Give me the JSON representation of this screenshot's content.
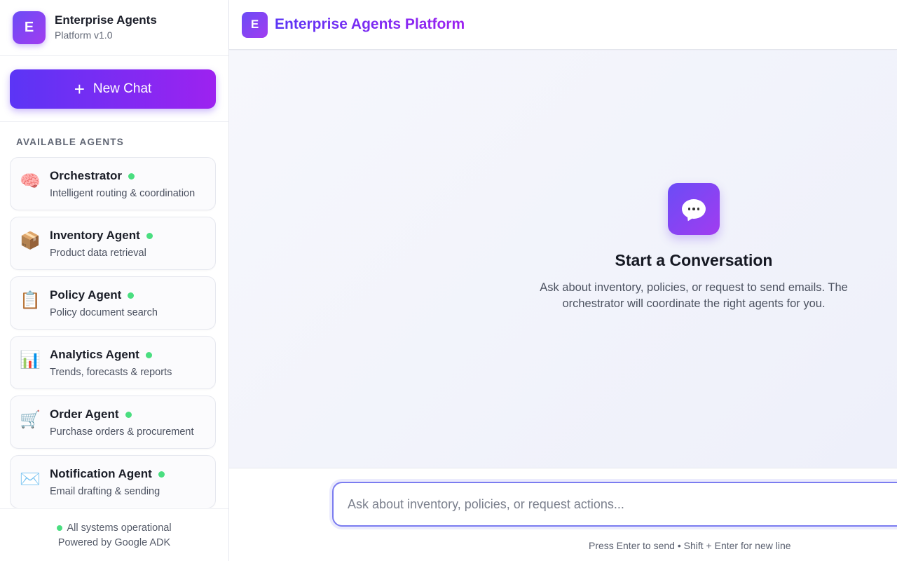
{
  "sidebar": {
    "brand": {
      "logo_letter": "E",
      "title": "Enterprise Agents",
      "subtitle": "Platform v1.0"
    },
    "new_chat": {
      "icon": "+",
      "label": "New Chat"
    },
    "section_label": "AVAILABLE AGENTS",
    "agents": [
      {
        "emoji": "🧠",
        "icon": "brain-icon",
        "name": "Orchestrator",
        "desc": "Intelligent routing & coordination",
        "status": "online"
      },
      {
        "emoji": "📦",
        "icon": "package-icon",
        "name": "Inventory Agent",
        "desc": "Product data retrieval",
        "status": "online"
      },
      {
        "emoji": "📋",
        "icon": "clipboard-icon",
        "name": "Policy Agent",
        "desc": "Policy document search",
        "status": "online"
      },
      {
        "emoji": "📊",
        "icon": "bar-chart-icon",
        "name": "Analytics Agent",
        "desc": "Trends, forecasts & reports",
        "status": "online"
      },
      {
        "emoji": "🛒",
        "icon": "shopping-cart-icon",
        "name": "Order Agent",
        "desc": "Purchase orders & procurement",
        "status": "online"
      },
      {
        "emoji": "✉️",
        "icon": "envelope-icon",
        "name": "Notification Agent",
        "desc": "Email drafting & sending",
        "status": "online"
      }
    ],
    "footer": {
      "status": "All systems operational",
      "powered_by": "Powered by Google ADK"
    }
  },
  "header": {
    "logo_letter": "E",
    "title": "Enterprise Agents Platform"
  },
  "empty_state": {
    "title": "Start a Conversation",
    "description": "Ask about inventory, policies, or request to send emails. The orchestrator will coordinate the right agents for you."
  },
  "composer": {
    "placeholder": "Ask about inventory, policies, or request actions...",
    "value": "",
    "hint": "Press Enter to send • Shift + Enter for new line"
  },
  "colors": {
    "accent_start": "#5b35f5",
    "accent_end": "#9d22f0",
    "status_online": "#4ade80"
  }
}
